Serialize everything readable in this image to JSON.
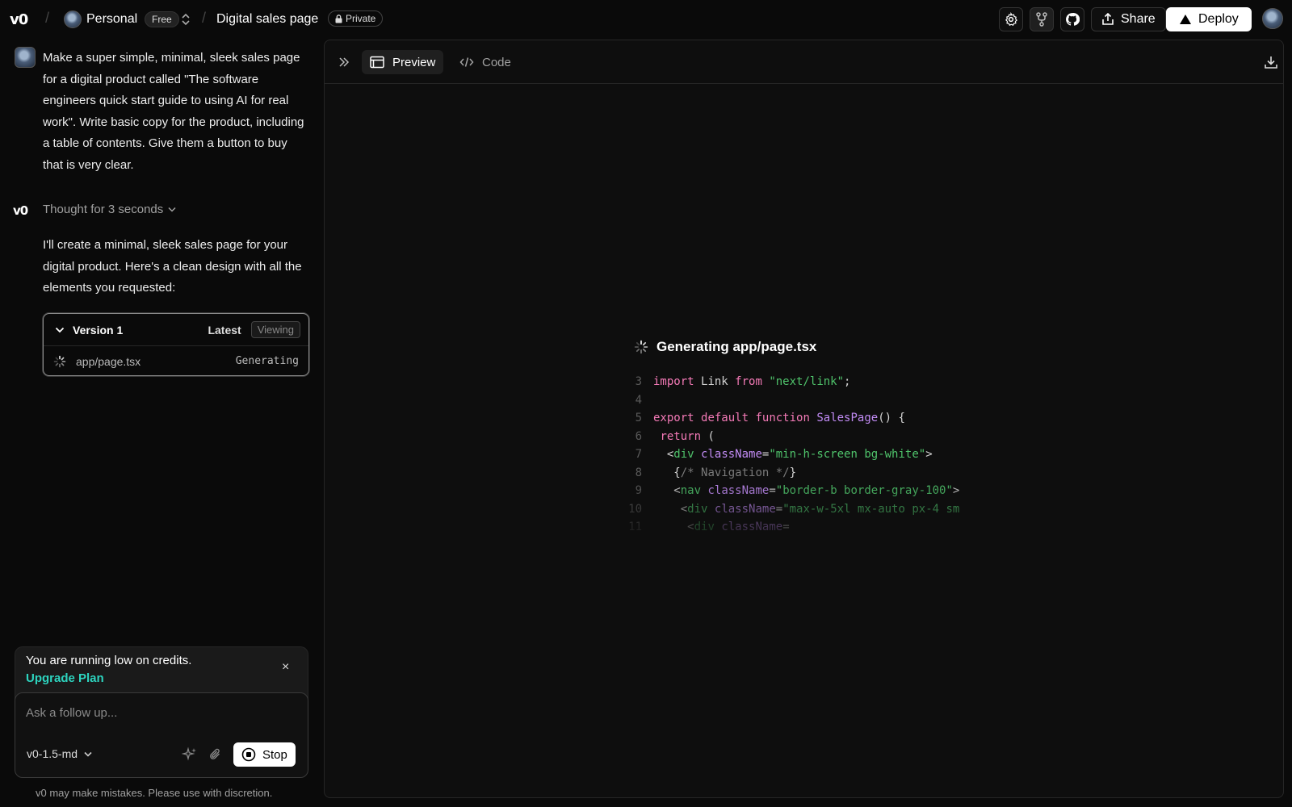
{
  "topbar": {
    "logo": "v0",
    "workspace": "Personal",
    "plan_badge": "Free",
    "project_name": "Digital sales page",
    "visibility": "Private",
    "share_label": "Share",
    "deploy_label": "Deploy"
  },
  "chat": {
    "user_message": "Make a super simple, minimal, sleek sales page for a digital product called \"The software engineers quick start guide to using AI for real work\". Write basic copy for the product, including a table of contents. Give them a button to buy that is very clear.",
    "thought_label": "Thought for 3 seconds",
    "assistant_message": "I'll create a minimal, sleek sales page for your digital product. Here's a clean design with all the elements you requested:",
    "version_card": {
      "title": "Version 1",
      "latest_label": "Latest",
      "viewing_label": "Viewing",
      "file_name": "app/page.tsx",
      "file_status": "Generating"
    },
    "credits": {
      "message": "You are running low on credits.",
      "upgrade_link": "Upgrade Plan"
    },
    "composer": {
      "placeholder": "Ask a follow up...",
      "model": "v0-1.5-md",
      "stop_label": "Stop"
    },
    "disclaimer": "v0 may make mistakes. Please use with discretion."
  },
  "preview": {
    "tabs": [
      {
        "label": "Preview",
        "active": true
      },
      {
        "label": "Code",
        "active": false
      }
    ],
    "generating_title": "Generating app/page.tsx",
    "code_lines": [
      {
        "n": "3",
        "text": "import Link from \"next/link\";"
      },
      {
        "n": "4",
        "text": ""
      },
      {
        "n": "5",
        "text": "export default function SalesPage() {"
      },
      {
        "n": "6",
        "text": " return ("
      },
      {
        "n": "7",
        "text": "  <div className=\"min-h-screen bg-white\">"
      },
      {
        "n": "8",
        "text": "   {/* Navigation */}"
      },
      {
        "n": "9",
        "text": "   <nav className=\"border-b border-gray-100\">"
      },
      {
        "n": "10",
        "text": "    <div className=\"max-w-5xl mx-auto px-4 sm"
      },
      {
        "n": "11",
        "text": "     <div className="
      }
    ]
  },
  "colors": {
    "background": "#0a0a0a",
    "panel": "#0e0e0e",
    "accent_link": "#2dd4bf",
    "keyword": "#f47ab7",
    "string": "#4fc36b",
    "function": "#c28cf5"
  }
}
